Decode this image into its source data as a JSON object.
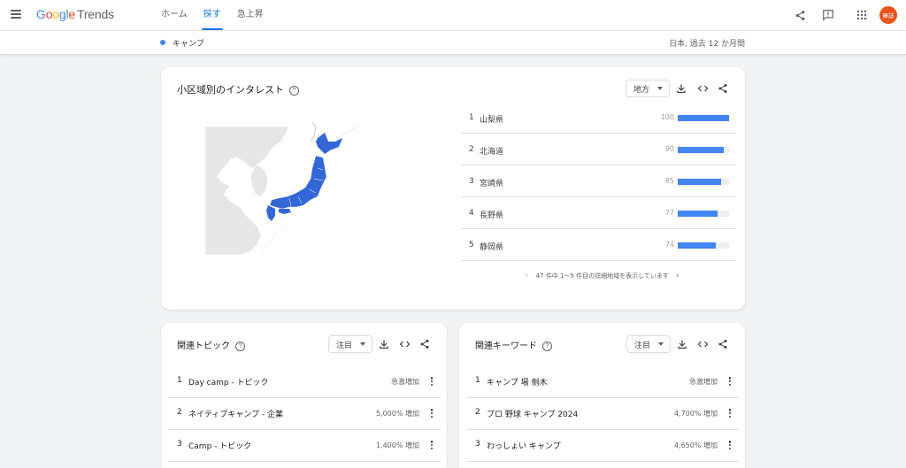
{
  "app": {
    "logo_google": "Google",
    "logo_trends": "Trends",
    "avatar_text": "暉誌"
  },
  "nav": [
    {
      "label": "ホーム",
      "active": false
    },
    {
      "label": "探す",
      "active": true
    },
    {
      "label": "急上昇",
      "active": false
    }
  ],
  "subheader": {
    "term": "キャンプ",
    "term_color": "#4285f4",
    "scope": "日本, 過去 12 か月間"
  },
  "region_card": {
    "title": "小区域別のインタレスト",
    "help": "?",
    "dropdown": "地方",
    "rows": [
      {
        "rank": "1",
        "name": "山梨県",
        "value": 100
      },
      {
        "rank": "2",
        "name": "北海道",
        "value": 90
      },
      {
        "rank": "3",
        "name": "宮崎県",
        "value": 85
      },
      {
        "rank": "4",
        "name": "長野県",
        "value": 77
      },
      {
        "rank": "5",
        "name": "静岡県",
        "value": 74
      }
    ],
    "pager_text": "47 件中 1～5 件目の詳細地域を表示しています"
  },
  "topics_card": {
    "title": "関連トピック",
    "help": "?",
    "dropdown": "注目",
    "rows": [
      {
        "rank": "1",
        "text": "Day camp - トピック",
        "growth": "急激増加"
      },
      {
        "rank": "2",
        "text": "ネイティブキャンプ - 企業",
        "growth": "5,000% 増加"
      },
      {
        "rank": "3",
        "text": "Camp - トピック",
        "growth": "1,400% 増加"
      }
    ]
  },
  "queries_card": {
    "title": "関連キーワード",
    "help": "?",
    "dropdown": "注目",
    "rows": [
      {
        "rank": "1",
        "text": "キャンプ 場 侧木",
        "growth": "急激増加"
      },
      {
        "rank": "2",
        "text": "プロ 野球 キャンプ 2024",
        "growth": "4,700% 増加"
      },
      {
        "rank": "3",
        "text": "わっしょい キャンプ",
        "growth": "4,650% 増加"
      }
    ]
  },
  "colors": {
    "accent": "#1a73e8",
    "bar": "#4285f4",
    "map_highlight": "#3367d6",
    "map_land": "#e6e6e6"
  }
}
